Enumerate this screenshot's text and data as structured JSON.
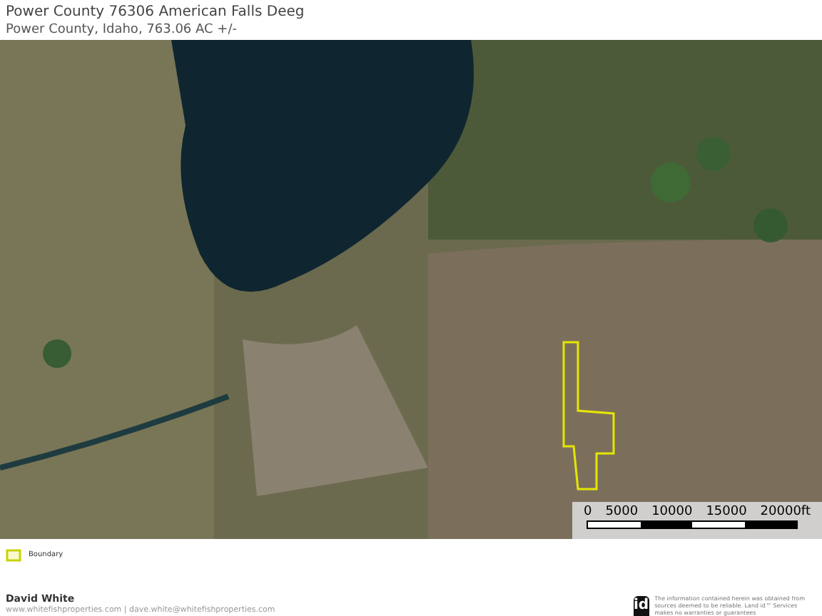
{
  "header": {
    "title": "Power County 76306 American Falls Deeg",
    "subtitle": "Power County, Idaho, 763.06 AC +/-"
  },
  "scale_bar": {
    "labels": [
      "0",
      "5000",
      "10000",
      "15000",
      "20000ft"
    ]
  },
  "legend": [
    {
      "label": "Boundary",
      "color": "#c8d400"
    }
  ],
  "footer": {
    "name": "David White",
    "contact": "www.whitefishproperties.com | dave.white@whitefishproperties.com",
    "logo": "id",
    "disclaimer": "The information contained herein was obtained from sources deemed to be reliable. Land id™ Services makes no warranties or guarantees"
  }
}
